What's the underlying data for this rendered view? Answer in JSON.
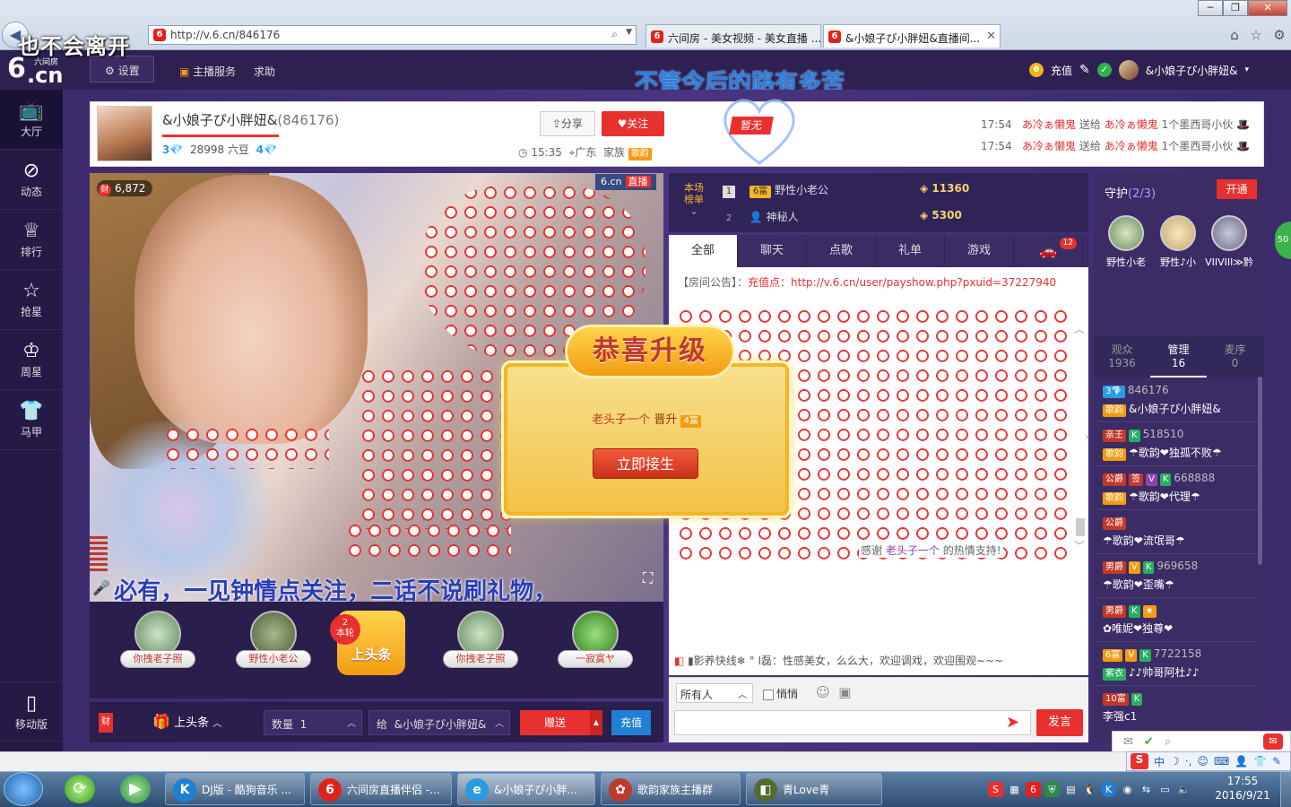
{
  "overlay_lyric": "也不会离开",
  "browser": {
    "url": "http://v.6.cn/846176",
    "tabs": [
      {
        "label": "六间房 - 美女视频 - 美女直播 ..."
      },
      {
        "label": "&小娘子ぴ小胖妞&直播间..."
      }
    ],
    "window_buttons": {
      "minimize": "─",
      "maximize": "❐",
      "close": "✕"
    }
  },
  "site": {
    "logo_sub": "六间房",
    "logo_six": "6",
    "logo_cn": ".cn",
    "settings_label": "设置",
    "anchor_service": "主播服务",
    "help": "求助",
    "slogan": "不管今后的路有多苦",
    "recharge": "充值",
    "username": "&小娘子ぴ小胖妞&"
  },
  "leftnav": [
    {
      "label": "大厅",
      "icon": "tv-icon"
    },
    {
      "label": "动态",
      "icon": "compass-icon"
    },
    {
      "label": "排行",
      "icon": "crown-icon"
    },
    {
      "label": "抢星",
      "icon": "star-icon"
    },
    {
      "label": "周星",
      "icon": "cup-icon"
    },
    {
      "label": "马甲",
      "icon": "vest-icon"
    }
  ],
  "mobile_label": "移动版",
  "anchor": {
    "name": "&小娘子ぴ小胖妞&",
    "room_id": "(846176)",
    "level_left": "3",
    "beans": "28998 六豆",
    "level_right": "4",
    "level_progress": 1.0,
    "share": "分享",
    "follow": "关注",
    "time": "15:35",
    "location": "广东",
    "family_label": "家族",
    "family_tag": "歌韵"
  },
  "top_badge": "暂无",
  "gift_messages": [
    {
      "time": "17:54",
      "from": "あ冷ぁ懒鬼",
      "verb": "送给",
      "to": "あ冷ぁ懒鬼",
      "gift": "1个墨西哥小伙"
    },
    {
      "time": "17:54",
      "from": "あ冷ぁ懒鬼",
      "verb": "送给",
      "to": "あ冷ぁ懒鬼",
      "gift": "1个墨西哥小伙"
    }
  ],
  "video": {
    "cai_count": "6,872",
    "cai_icon": "财",
    "brand": "6.cn",
    "live": "直播",
    "scroll_text": "必有，一见钟情点关注，二话不说刷礼物，"
  },
  "levelup": {
    "title": "恭喜升级",
    "user": "老头子一个",
    "verb": "晋升",
    "rank": "4富",
    "button": "立即接生"
  },
  "gifts": [
    {
      "label": "你拽老子照"
    },
    {
      "label": "野性小老公"
    },
    {
      "label": "你拽老子照"
    },
    {
      "label": "一寂寞ヤ"
    }
  ],
  "headline_gift": {
    "label": "上头条",
    "round_num": "2",
    "round_label": "本轮"
  },
  "send_bar": {
    "cai": "财",
    "headline_button": "上头条",
    "qty_label": "数量",
    "qty_value": "1",
    "to_label": "给",
    "to_value": "&小娘子ぴ小胖妞&",
    "send": "赠送",
    "recharge": "充值"
  },
  "ranking": {
    "label": "本场榜单",
    "rows": [
      {
        "rank": "1",
        "tag": "6富",
        "name": "野性小老公",
        "value": "11360"
      },
      {
        "rank": "2",
        "tag": "",
        "name": "神秘人",
        "value": "5300"
      }
    ]
  },
  "chat_tabs": [
    {
      "label": "全部"
    },
    {
      "label": "聊天"
    },
    {
      "label": "点歌"
    },
    {
      "label": "礼单"
    },
    {
      "label": "游戏"
    },
    {
      "label": "",
      "badge": "12"
    }
  ],
  "chat": {
    "notice_label": "【房间公告】：",
    "notice_prefix": "充值点：",
    "notice_link": "http://v.6.cn/user/payshow.php?pxuid=37227940",
    "thanks_prefix": "感谢",
    "thanks_user": "老头子一个",
    "thanks_suffix": "的热情支持!",
    "marquee": "▮影养快线❄ ° I磊：性感美女，么么大，欢迎调戏，欢迎围观~~~",
    "to_all": "所有人",
    "whisper": "悄悄",
    "post": "发言"
  },
  "guard": {
    "title": "守护",
    "count": "(2/3)",
    "open": "开通",
    "members": [
      {
        "name": "野性小老"
      },
      {
        "name": "野性♪小"
      },
      {
        "name": "VIIVIII≫黔"
      }
    ]
  },
  "audience_tabs": [
    {
      "label": "观众",
      "count": "1936"
    },
    {
      "label": "管理",
      "count": "16"
    },
    {
      "label": "麦序",
      "count": "0"
    }
  ],
  "users": [
    {
      "badges": [
        [
          "b",
          "3💎"
        ]
      ],
      "id": "846176",
      "tags": [
        [
          "o",
          "歌韵"
        ]
      ],
      "name": "&小娘子ぴ小胖妞&"
    },
    {
      "badges": [
        [
          "r",
          "亲王"
        ],
        [
          "g",
          "K"
        ]
      ],
      "id": "518510",
      "tags": [
        [
          "o",
          "歌韵"
        ]
      ],
      "name": "☂歌韵❤独孤不败☂"
    },
    {
      "badges": [
        [
          "r",
          "公爵"
        ],
        [
          "r",
          "签"
        ],
        [
          "p",
          "V"
        ],
        [
          "g",
          "K"
        ]
      ],
      "id": "668888",
      "tags": [
        [
          "o",
          "歌韵"
        ]
      ],
      "name": "☂歌韵❤代理☂"
    },
    {
      "badges": [
        [
          "r",
          "公爵"
        ]
      ],
      "id": "",
      "tags": [],
      "name": "☂歌韵❤流氓哥☂"
    },
    {
      "badges": [
        [
          "r",
          "男爵"
        ],
        [
          "o",
          "V"
        ],
        [
          "g",
          "K"
        ]
      ],
      "id": "969658",
      "tags": [],
      "name": "☂歌韵❤歪嘴☂"
    },
    {
      "badges": [
        [
          "r",
          "男爵"
        ],
        [
          "g",
          "K"
        ],
        [
          "o",
          "★"
        ]
      ],
      "id": "",
      "tags": [],
      "name": "✿唯妮❤独尊❤"
    },
    {
      "badges": [
        [
          "o",
          "6富"
        ],
        [
          "o",
          "V"
        ],
        [
          "g",
          "K"
        ]
      ],
      "id": "7722158",
      "tags": [
        [
          "g",
          "紫衣"
        ]
      ],
      "name": "♪♪帅哥阿杜♪♪"
    },
    {
      "badges": [
        [
          "r",
          "10富"
        ],
        [
          "g",
          "K"
        ]
      ],
      "id": "",
      "tags": [],
      "name": "李强c1"
    }
  ],
  "side_ball": "50",
  "ime": {
    "s": "S",
    "mode": "中"
  },
  "taskbar": {
    "items": [
      {
        "label": "DJ版 - 酷狗音乐 ...",
        "icon": "K",
        "color": "#1e7fd4"
      },
      {
        "label": "六间房直播伴侣 -...",
        "icon": "6",
        "color": "#e1221a"
      },
      {
        "label": "&小娘子ぴ小胖...",
        "icon": "e",
        "color": "#2a9be0"
      },
      {
        "label": "歌韵家族主播群",
        "icon": "✿",
        "color": "#c0392b"
      },
      {
        "label": "青Love青",
        "icon": "◧",
        "color": "#556b2f"
      }
    ],
    "time": "17:55",
    "date": "2016/9/21"
  }
}
